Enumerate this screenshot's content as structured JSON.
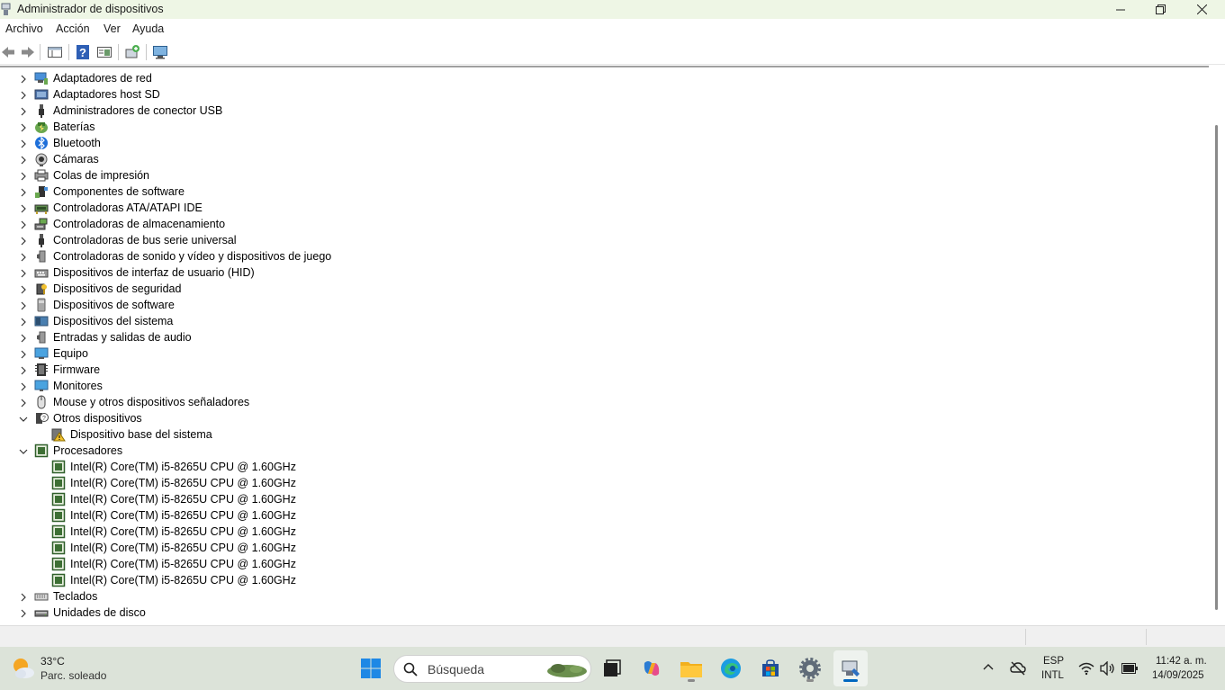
{
  "window": {
    "title": "Administrador de dispositivos",
    "icon": "device-manager-icon",
    "controls": [
      "minimize-icon",
      "restore-icon",
      "close-icon"
    ]
  },
  "menu": {
    "archivo": "Archivo",
    "accion": "Acción",
    "ver": "Ver",
    "ayuda": "Ayuda"
  },
  "toolbar": {
    "buttons": [
      "back-icon",
      "forward-icon",
      "properties-view-icon",
      "help-icon",
      "show-hidden-icon",
      "update-driver-icon",
      "scan-hardware-icon"
    ]
  },
  "tree": {
    "categories": [
      {
        "label": "Adaptadores de red",
        "icon": "network-adapter-icon"
      },
      {
        "label": "Adaptadores host SD",
        "icon": "sd-host-icon"
      },
      {
        "label": "Administradores de conector USB",
        "icon": "usb-connector-icon"
      },
      {
        "label": "Baterías",
        "icon": "battery-icon"
      },
      {
        "label": "Bluetooth",
        "icon": "bluetooth-icon"
      },
      {
        "label": "Cámaras",
        "icon": "camera-icon"
      },
      {
        "label": "Colas de impresión",
        "icon": "printer-icon"
      },
      {
        "label": "Componentes de software",
        "icon": "software-component-icon"
      },
      {
        "label": "Controladoras ATA/ATAPI IDE",
        "icon": "ide-controller-icon"
      },
      {
        "label": "Controladoras de almacenamiento",
        "icon": "storage-controller-icon"
      },
      {
        "label": "Controladoras de bus serie universal",
        "icon": "usb-icon"
      },
      {
        "label": "Controladoras de sonido y vídeo y dispositivos de juego",
        "icon": "speaker-icon"
      },
      {
        "label": "Dispositivos de interfaz de usuario (HID)",
        "icon": "hid-icon"
      },
      {
        "label": "Dispositivos de seguridad",
        "icon": "security-device-icon"
      },
      {
        "label": "Dispositivos de software",
        "icon": "software-device-icon"
      },
      {
        "label": "Dispositivos del sistema",
        "icon": "system-device-icon"
      },
      {
        "label": "Entradas y salidas de audio",
        "icon": "speaker-icon"
      },
      {
        "label": "Equipo",
        "icon": "computer-icon"
      },
      {
        "label": "Firmware",
        "icon": "firmware-icon"
      },
      {
        "label": "Monitores",
        "icon": "monitor-icon"
      },
      {
        "label": "Mouse y otros dispositivos señaladores",
        "icon": "mouse-icon"
      },
      {
        "label": "Otros dispositivos",
        "icon": "unknown-device-icon",
        "expanded": true,
        "children": [
          {
            "label": "Dispositivo base del sistema",
            "icon": "warning-device-icon"
          }
        ]
      },
      {
        "label": "Procesadores",
        "icon": "processor-icon",
        "expanded": true,
        "children": [
          {
            "label": "Intel(R) Core(TM) i5-8265U CPU @ 1.60GHz",
            "icon": "processor-icon"
          },
          {
            "label": "Intel(R) Core(TM) i5-8265U CPU @ 1.60GHz",
            "icon": "processor-icon"
          },
          {
            "label": "Intel(R) Core(TM) i5-8265U CPU @ 1.60GHz",
            "icon": "processor-icon"
          },
          {
            "label": "Intel(R) Core(TM) i5-8265U CPU @ 1.60GHz",
            "icon": "processor-icon"
          },
          {
            "label": "Intel(R) Core(TM) i5-8265U CPU @ 1.60GHz",
            "icon": "processor-icon"
          },
          {
            "label": "Intel(R) Core(TM) i5-8265U CPU @ 1.60GHz",
            "icon": "processor-icon"
          },
          {
            "label": "Intel(R) Core(TM) i5-8265U CPU @ 1.60GHz",
            "icon": "processor-icon"
          },
          {
            "label": "Intel(R) Core(TM) i5-8265U CPU @ 1.60GHz",
            "icon": "processor-icon"
          }
        ]
      },
      {
        "label": "Teclados",
        "icon": "keyboard-icon"
      },
      {
        "label": "Unidades de disco",
        "icon": "disk-drive-icon"
      }
    ]
  },
  "taskbar": {
    "weather": {
      "temp": "33°C",
      "desc": "Parc. soleado",
      "icon": "weather-sun-cloud-icon"
    },
    "search_placeholder": "Búsqueda",
    "apps": [
      "windows-start-icon",
      "task-view-icon",
      "copilot-icon",
      "file-explorer-icon",
      "edge-icon",
      "store-icon",
      "settings-icon",
      "device-manager-icon"
    ],
    "tray": {
      "lang_top": "ESP",
      "lang_bottom": "INTL",
      "time": "11:42 a. m.",
      "date": "14/09/2025",
      "icons": [
        "chevron-up-icon",
        "sync-off-icon",
        "wifi-icon",
        "volume-icon",
        "battery-icon"
      ]
    }
  },
  "colors": {
    "title_bg": "#eef6e5",
    "taskbar_bg": "#dce3d9",
    "accent": "#0067c0"
  }
}
